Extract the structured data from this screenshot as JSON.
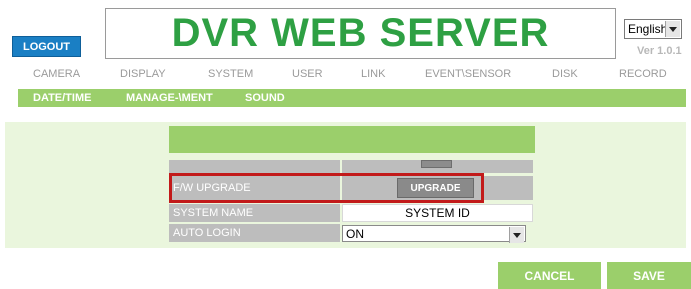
{
  "header": {
    "logout_label": "LOGOUT",
    "title": "DVR WEB SERVER",
    "language": "English",
    "version": "Ver 1.0.1"
  },
  "main_nav": [
    "CAMERA",
    "DISPLAY",
    "SYSTEM",
    "USER",
    "LINK",
    "EVENT\\SENSOR",
    "DISK",
    "RECORD"
  ],
  "sub_nav": [
    "DATE/TIME",
    "MANAGE-\\MENT",
    "SOUND"
  ],
  "form": {
    "fw_upgrade_label": "F/W UPGRADE",
    "upgrade_button": "UPGRADE",
    "system_name_label": "SYSTEM NAME",
    "system_name_value": "SYSTEM ID",
    "auto_login_label": "AUTO LOGIN",
    "auto_login_value": "ON"
  },
  "actions": {
    "cancel": "CANCEL",
    "save": "SAVE"
  },
  "colors": {
    "accent_green": "#9bcf6b",
    "title_green": "#2ea043",
    "logout_blue": "#1a7fc4",
    "highlight_red": "#c21a1a"
  }
}
